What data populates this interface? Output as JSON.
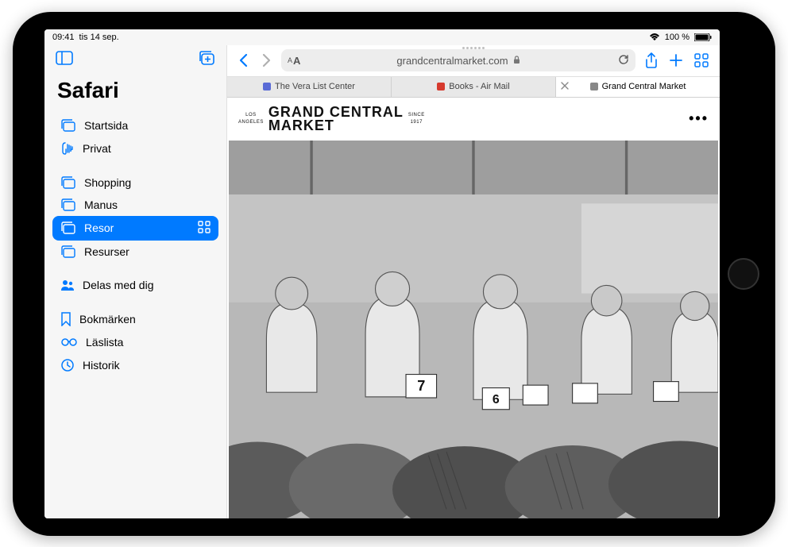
{
  "status": {
    "time": "09:41",
    "date": "tis 14 sep.",
    "battery_pct": "100 %"
  },
  "sidebar": {
    "title": "Safari",
    "items": [
      {
        "label": "Startsida",
        "icon": "tabs"
      },
      {
        "label": "Privat",
        "icon": "hand"
      }
    ],
    "groups": [
      {
        "label": "Shopping",
        "icon": "tabs"
      },
      {
        "label": "Manus",
        "icon": "tabs"
      },
      {
        "label": "Resor",
        "icon": "tabs",
        "selected": true,
        "trail": "grid"
      },
      {
        "label": "Resurser",
        "icon": "tabs"
      }
    ],
    "shared": {
      "label": "Delas med dig",
      "icon": "people"
    },
    "footer": [
      {
        "label": "Bokmärken",
        "icon": "bookmark"
      },
      {
        "label": "Läslista",
        "icon": "glasses"
      },
      {
        "label": "Historik",
        "icon": "clock"
      }
    ]
  },
  "toolbar": {
    "url": "grandcentralmarket.com"
  },
  "tabs": [
    {
      "label": "The Vera List Center",
      "favcolor": "#5a6bd6"
    },
    {
      "label": "Books - Air Mail",
      "favcolor": "#d63a2e"
    },
    {
      "label": "Grand Central Market",
      "favcolor": "#888",
      "active": true,
      "closable": true
    }
  ],
  "page": {
    "logo_line1": "GRAND CENTRAL",
    "logo_line2": "MARKET",
    "logo_left": "LOS\nANGELES",
    "logo_right": "SINCE\n1917",
    "menu": "•••"
  }
}
